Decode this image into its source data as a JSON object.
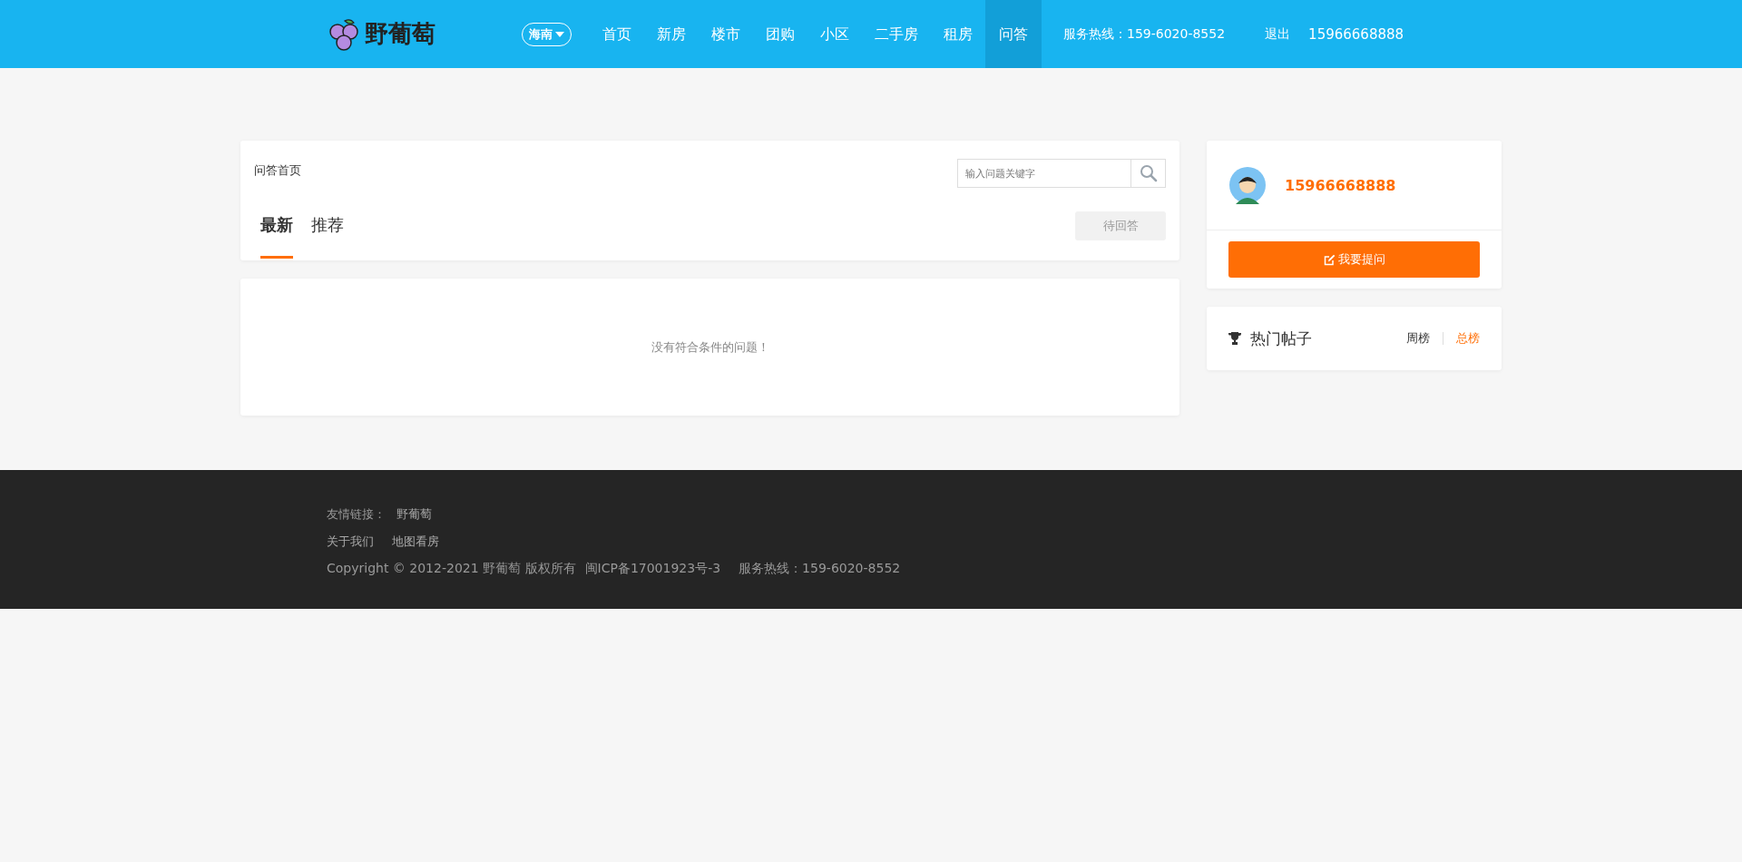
{
  "header": {
    "logo_text": "野葡萄",
    "city": "海南",
    "nav": [
      {
        "label": "首页",
        "selected": false
      },
      {
        "label": "新房",
        "selected": false
      },
      {
        "label": "楼市",
        "selected": false
      },
      {
        "label": "团购",
        "selected": false
      },
      {
        "label": "小区",
        "selected": false
      },
      {
        "label": "二手房",
        "selected": false
      },
      {
        "label": "租房",
        "selected": false
      },
      {
        "label": "问答",
        "selected": true
      }
    ],
    "hotline": "服务热线：159-6020-8552",
    "logout": "退出",
    "user": "15966668888"
  },
  "qa": {
    "breadcrumb": "问答首页",
    "search": {
      "placeholder": "输入问题关键字"
    },
    "tabs": [
      {
        "label": "最新",
        "selected": true
      },
      {
        "label": "推荐",
        "selected": false
      }
    ],
    "pending_button": "待回答",
    "empty_message": "没有符合条件的问题！"
  },
  "user_card": {
    "name": "15966668888",
    "ask_button": "我要提问"
  },
  "hot_posts": {
    "title": "热门帖子",
    "tabs": [
      {
        "label": "周榜",
        "selected": false
      },
      {
        "label": "总榜",
        "selected": true
      }
    ]
  },
  "footer": {
    "friend_links_label": "友情链接：",
    "friend_links": [
      "野葡萄"
    ],
    "links": [
      "关于我们",
      "地图看房"
    ],
    "copyright": "Copyright © 2012-2021 野葡萄 版权所有",
    "icp": "闽ICP备17001923号-3",
    "hotline": "服务热线：159-6020-8552"
  }
}
